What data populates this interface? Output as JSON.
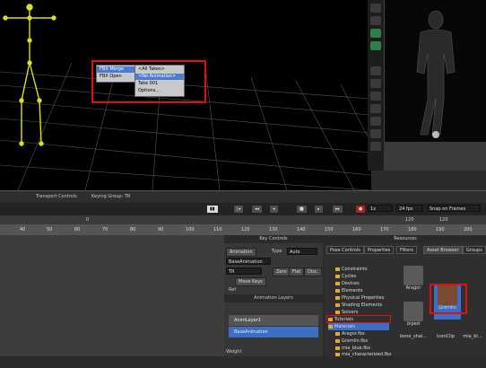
{
  "fbx_menu": {
    "merge_label": "FBX Merge",
    "open_label": "FBX Open",
    "submenu": [
      "<All Takes>",
      "<No Animation>",
      "Take 001",
      "Options..."
    ]
  },
  "transport": {
    "title": "Transport Controls",
    "keying_group": "Keying Group: TR",
    "fps": "24 fps",
    "snap": "Snap on Frames",
    "speed": "1x",
    "start": "0",
    "end": "120",
    "end2": "120"
  },
  "ruler_ticks": [
    "40",
    "50",
    "60",
    "70",
    "80",
    "90",
    "100",
    "110",
    "120",
    "130",
    "140",
    "150",
    "160",
    "170",
    "180",
    "190",
    "200"
  ],
  "key_controls": {
    "title": "Key Controls",
    "tab_animation": "Animation",
    "type_label": "Type",
    "type_value": "Auto",
    "base_anim": "BaseAnimation",
    "tr_label": "TR",
    "zero": "Zero",
    "flat": "Flat",
    "disc": "Disc.",
    "move_keys": "Move Keys",
    "ref": "Ref"
  },
  "anim_layers": {
    "title": "Animation Layers",
    "rows": [
      "AnimLayer1",
      "BaseAnimation"
    ],
    "weight": "Weight"
  },
  "resources": {
    "title": "Resources",
    "tabs": [
      "Pose Controls",
      "Properties",
      "Filters",
      "Asset Browser",
      "Groups"
    ],
    "tree": [
      "Constraints",
      "Cycles",
      "Devices",
      "Elements",
      "Physical Properties",
      "Shading Elements",
      "Solvers",
      "Tutorials",
      "Materials",
      "Aragor.fbx",
      "Gremlin.fbx",
      "mia_blue.fbx",
      "mia_characterized.fbx"
    ],
    "assets": [
      "Aragor",
      "Gremlin",
      "biped",
      "bone_shal...",
      "IconClip",
      "mia_bl..."
    ]
  },
  "colors": {
    "skeleton": "#d8e020",
    "highlight": "#e01010",
    "selected": "#4a7bd0"
  }
}
